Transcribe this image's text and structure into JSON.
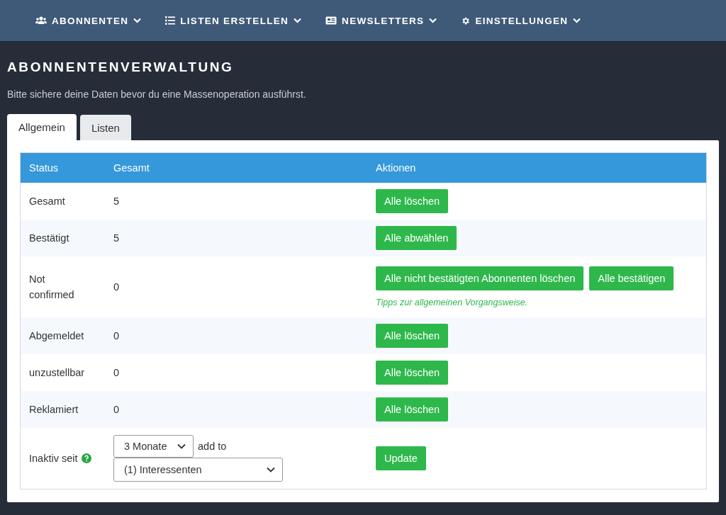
{
  "nav": [
    {
      "label": "ABONNENTEN"
    },
    {
      "label": "LISTEN ERSTELLEN"
    },
    {
      "label": "NEWSLETTERS"
    },
    {
      "label": "EINSTELLUNGEN"
    }
  ],
  "page": {
    "title": "ABONNENTENVERWALTUNG",
    "notice": "Bitte sichere deine Daten bevor du eine Massenoperation ausführst."
  },
  "tabs": [
    {
      "label": "Allgemein",
      "selected": true
    },
    {
      "label": "Listen",
      "selected": false
    }
  ],
  "table": {
    "columns": [
      "Status",
      "Gesamt",
      "Aktionen"
    ],
    "rows": [
      {
        "kind": "count",
        "status": "Gesamt",
        "total": "5",
        "actions": [
          "Alle löschen"
        ]
      },
      {
        "kind": "count",
        "status": "Bestätigt",
        "total": "5",
        "actions": [
          "Alle abwählen"
        ]
      },
      {
        "kind": "count",
        "status": "Not confirmed",
        "total": "0",
        "actions": [
          "Alle nicht bestätigten Abonnenten löschen",
          "Alle bestätigen"
        ],
        "tip": "Tipps zur allgemeinen Vorgangsweise."
      },
      {
        "kind": "count",
        "status": "Abgemeldet",
        "total": "0",
        "actions": [
          "Alle löschen"
        ]
      },
      {
        "kind": "count",
        "status": "unzustellbar",
        "total": "0",
        "actions": [
          "Alle löschen"
        ]
      },
      {
        "kind": "count",
        "status": "Reklamiert",
        "total": "0",
        "actions": [
          "Alle löschen"
        ]
      },
      {
        "kind": "inactive",
        "status": "Inaktiv seit",
        "period": "3 Monate",
        "connector": "add to",
        "list": "(1) Interessenten",
        "actions": [
          "Update"
        ]
      }
    ]
  }
}
